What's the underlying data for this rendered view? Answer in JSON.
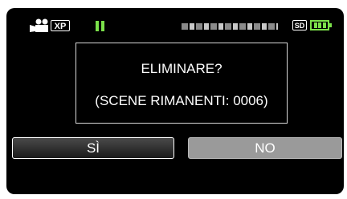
{
  "status_bar": {
    "mode_icon": "video-camera-icon",
    "quality": "XP",
    "state_icon": "pause-icon",
    "media": "SD",
    "battery_icon": "battery-full-icon"
  },
  "dialog": {
    "question": "ELIMINARE?",
    "remaining": "(SCENE RIMANENTI: 0006)"
  },
  "buttons": {
    "yes_label": "SÌ",
    "no_label": "NO"
  },
  "colors": {
    "accent_green": "#7be04a",
    "screen_bg": "#000000",
    "selected_button": "#9a9a9a"
  }
}
